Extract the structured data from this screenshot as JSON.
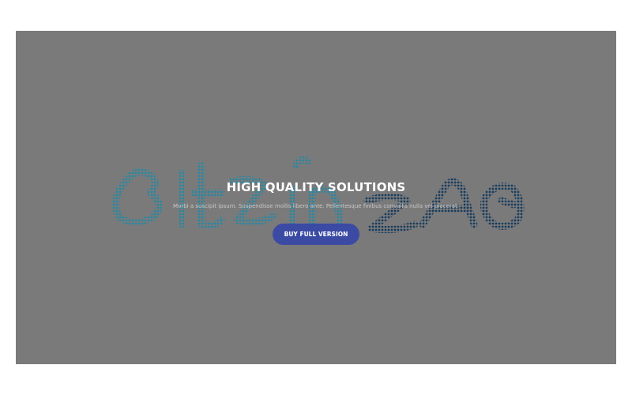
{
  "hero": {
    "background_color": "#7b7a7b",
    "title": "HIGH QUALITY SOLUTIONS",
    "subtitle": "Morbi a suscipit ipsum. Suspendisse mollis libero ante. Pellentesque finibus convallis nulla vel placerat.",
    "cta_label": "BUY FULL VERSION",
    "cta_color": "#3b4aa3"
  },
  "logo_art": {
    "accent_teal": "#1e8aa6",
    "accent_navy": "#123a5c"
  }
}
